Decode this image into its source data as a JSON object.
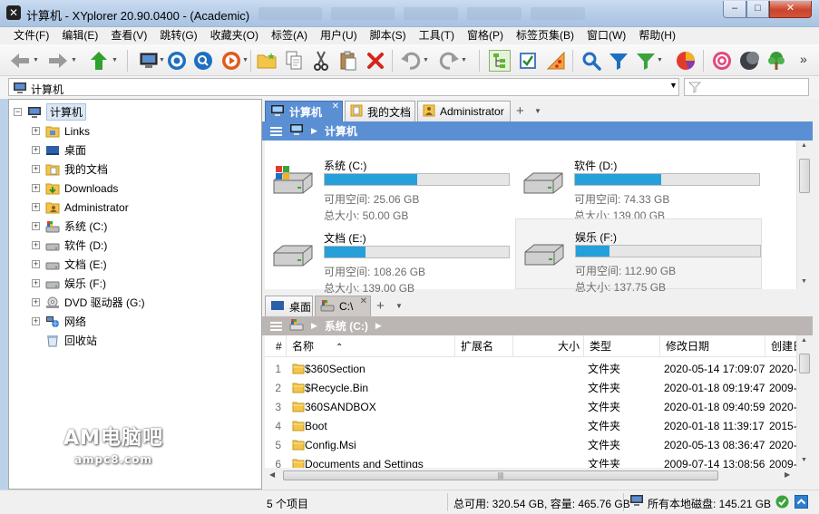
{
  "window": {
    "title": "计算机 - XYplorer 20.90.0400 - (Academic)",
    "minimize": "–",
    "maximize": "□",
    "close": "✕"
  },
  "menu": [
    "文件(F)",
    "编辑(E)",
    "查看(V)",
    "跳转(G)",
    "收藏夹(O)",
    "标签(A)",
    "用户(U)",
    "脚本(S)",
    "工具(T)",
    "窗格(P)",
    "标签页集(B)",
    "窗口(W)",
    "帮助(H)"
  ],
  "toolbar": {
    "more": "»"
  },
  "address": {
    "value": "计算机"
  },
  "tree": {
    "root": "计算机",
    "items": [
      "Links",
      "桌面",
      "我的文档",
      "Downloads",
      "Administrator",
      "系统 (C:)",
      "软件 (D:)",
      "文档 (E:)",
      "娱乐 (F:)",
      "DVD 驱动器 (G:)",
      "网络",
      "回收站"
    ]
  },
  "pane1": {
    "tabs": [
      {
        "label": "计算机"
      },
      {
        "label": "我的文档"
      },
      {
        "label": "Administrator"
      }
    ],
    "crumb": "计算机",
    "drives": [
      {
        "name": "系统 (C:)",
        "free": "可用空间: 25.06 GB",
        "total": "总大小: 50.00 GB",
        "used_fraction": 0.5
      },
      {
        "name": "软件 (D:)",
        "free": "可用空间: 74.33 GB",
        "total": "总大小: 139.00 GB",
        "used_fraction": 0.47
      },
      {
        "name": "文档 (E:)",
        "free": "可用空间: 108.26 GB",
        "total": "总大小: 139.00 GB",
        "used_fraction": 0.22
      },
      {
        "name": "娱乐 (F:)",
        "free": "可用空间: 112.90 GB",
        "total": "总大小: 137.75 GB",
        "used_fraction": 0.18
      }
    ]
  },
  "pane2": {
    "tabs": [
      {
        "label": "桌面"
      },
      {
        "label": "C:\\"
      }
    ],
    "crumb": "系统 (C:)",
    "columns": [
      "#",
      "名称",
      "扩展名",
      "大小",
      "类型",
      "修改日期",
      "创建日"
    ],
    "rows": [
      {
        "num": "1",
        "name": "$360Section",
        "ext": "",
        "size": "",
        "type": "文件夹",
        "modified": "2020-05-14 17:09:07",
        "created": "2020-"
      },
      {
        "num": "2",
        "name": "$Recycle.Bin",
        "ext": "",
        "size": "",
        "type": "文件夹",
        "modified": "2020-01-18 09:19:47",
        "created": "2009-"
      },
      {
        "num": "3",
        "name": "360SANDBOX",
        "ext": "",
        "size": "",
        "type": "文件夹",
        "modified": "2020-01-18 09:40:59",
        "created": "2020-"
      },
      {
        "num": "4",
        "name": "Boot",
        "ext": "",
        "size": "",
        "type": "文件夹",
        "modified": "2020-01-18 11:39:17",
        "created": "2015-"
      },
      {
        "num": "5",
        "name": "Config.Msi",
        "ext": "",
        "size": "",
        "type": "文件夹",
        "modified": "2020-05-13 08:36:47",
        "created": "2020-"
      },
      {
        "num": "6",
        "name": "Documents and Settings",
        "ext": "",
        "size": "",
        "type": "文件夹",
        "modified": "2009-07-14 13:08:56",
        "created": "2009-"
      }
    ]
  },
  "status": {
    "items": "5 个项目",
    "capacity": "总可用: 320.54 GB, 容量: 465.76 GB",
    "all_disks": "所有本地磁盘: 145.21 GB"
  },
  "watermark": {
    "title": "AM电脑吧",
    "sub": "ampc8.com"
  },
  "colors": {
    "accent": "#5b8fd4",
    "drive_bar": "#26a0da"
  }
}
